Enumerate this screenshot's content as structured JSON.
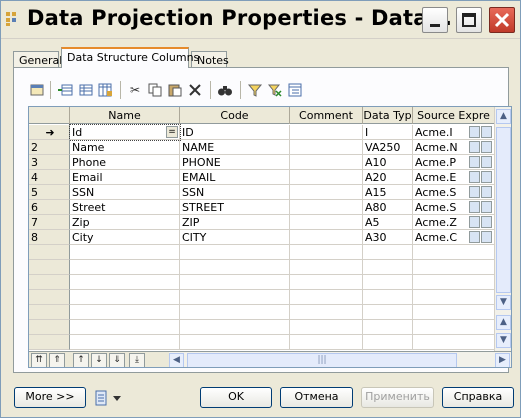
{
  "window": {
    "title": "Data Projection Properties - Data..."
  },
  "tabs": [
    "General",
    "Data Structure Columns",
    "Notes"
  ],
  "toolbar_icons": [
    "properties-icon",
    "insert-row-icon",
    "add-row-icon",
    "add-columns-icon",
    "cut-icon",
    "copy-icon",
    "paste-icon",
    "delete-icon",
    "find-icon",
    "filter-icon",
    "filter-clear-icon",
    "customize-columns-icon"
  ],
  "grid": {
    "columns": [
      "Name",
      "Code",
      "Comment",
      "Data Typ",
      "Source Expre"
    ],
    "current_marker": "➜",
    "rows": [
      {
        "num": "",
        "name": "Id",
        "code": "ID",
        "comment": "",
        "type": "I",
        "source": "Acme.I"
      },
      {
        "num": "2",
        "name": "Name",
        "code": "NAME",
        "comment": "",
        "type": "VA250",
        "source": "Acme.N"
      },
      {
        "num": "3",
        "name": "Phone",
        "code": "PHONE",
        "comment": "",
        "type": "A10",
        "source": "Acme.P"
      },
      {
        "num": "4",
        "name": "Email",
        "code": "EMAIL",
        "comment": "",
        "type": "A20",
        "source": "Acme.E"
      },
      {
        "num": "5",
        "name": "SSN",
        "code": "SSN",
        "comment": "",
        "type": "A15",
        "source": "Acme.S"
      },
      {
        "num": "6",
        "name": "Street",
        "code": "STREET",
        "comment": "",
        "type": "A80",
        "source": "Acme.S"
      },
      {
        "num": "7",
        "name": "Zip",
        "code": "ZIP",
        "comment": "",
        "type": "A5",
        "source": "Acme.Z"
      },
      {
        "num": "8",
        "name": "City",
        "code": "CITY",
        "comment": "",
        "type": "A30",
        "source": "Acme.C"
      }
    ],
    "empty_rows": 7
  },
  "buttons": {
    "more": "More >>",
    "ok": "OK",
    "cancel": "Отмена",
    "apply": "Применить",
    "help": "Справка"
  }
}
